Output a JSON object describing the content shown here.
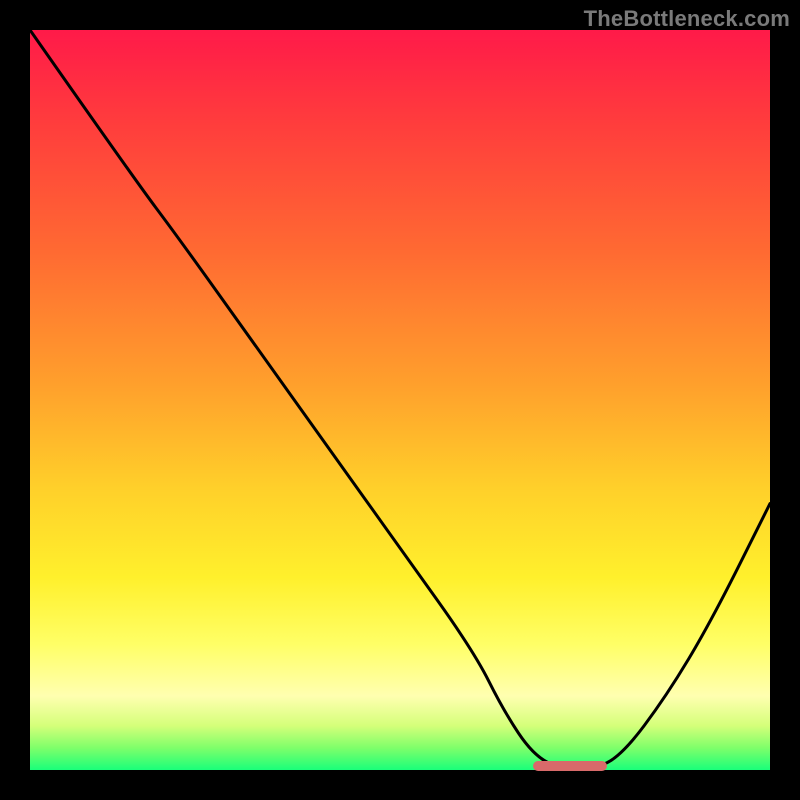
{
  "watermark": "TheBottleneck.com",
  "colors": {
    "frame": "#000000",
    "gradient_top": "#ff1a49",
    "gradient_mid": "#ffd02a",
    "gradient_bottom": "#1aff7a",
    "curve": "#000000",
    "marker": "#d86a6a"
  },
  "chart_data": {
    "type": "line",
    "title": "",
    "xlabel": "",
    "ylabel": "",
    "xlim": [
      0,
      100
    ],
    "ylim": [
      0,
      100
    ],
    "grid": false,
    "series": [
      {
        "name": "bottleneck-curve",
        "x": [
          0,
          14,
          20,
          30,
          40,
          50,
          60,
          64,
          68,
          72,
          76,
          80,
          86,
          92,
          100
        ],
        "y": [
          100,
          80,
          72,
          58,
          44,
          30,
          16,
          8,
          2,
          0,
          0,
          2,
          10,
          20,
          36
        ]
      }
    ],
    "marker": {
      "x_start": 68,
      "x_end": 78,
      "y": 0
    }
  }
}
